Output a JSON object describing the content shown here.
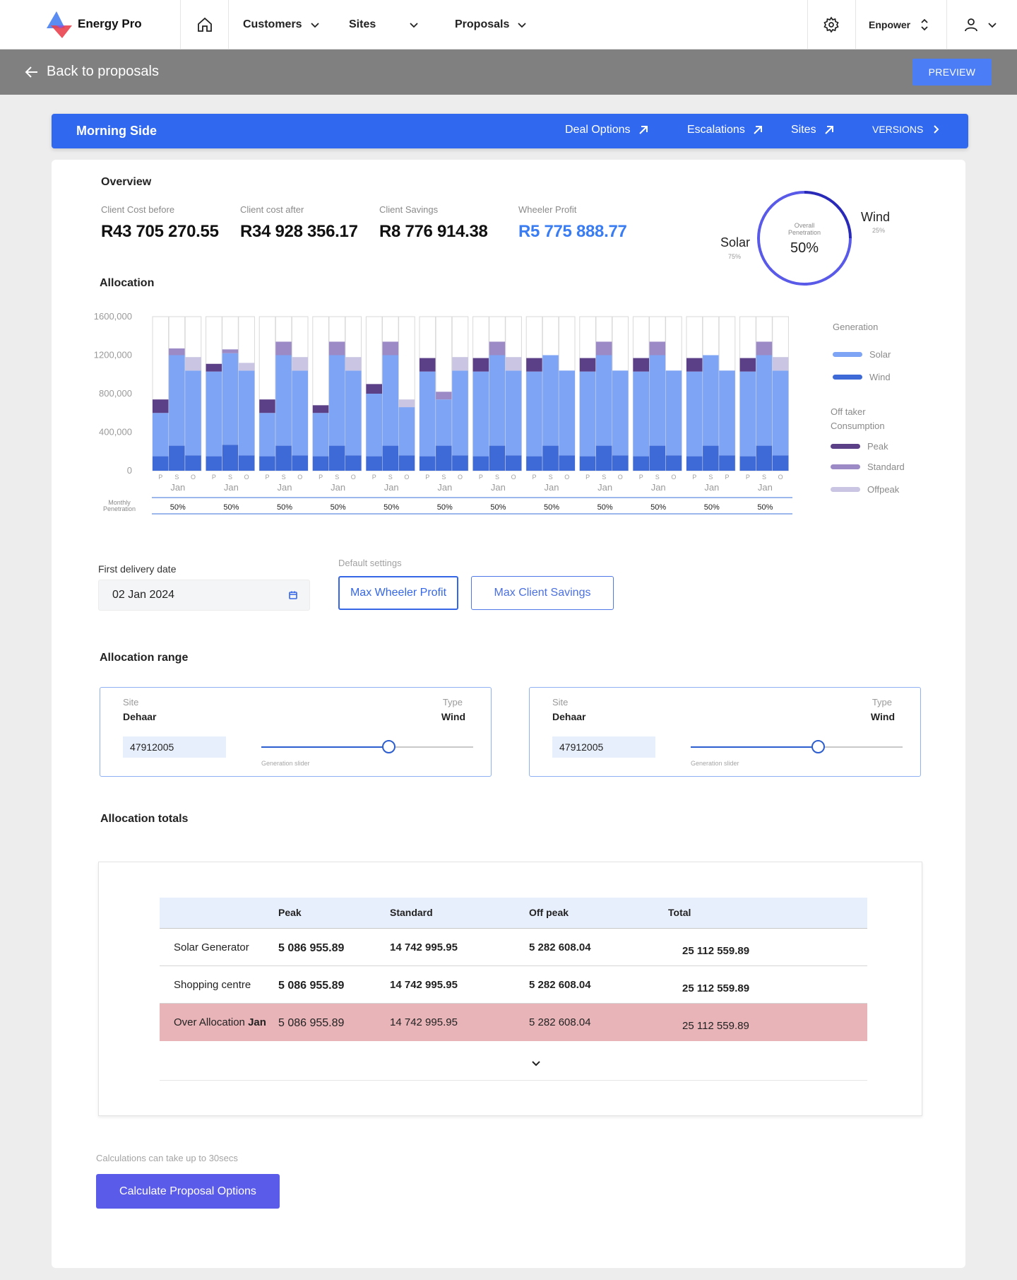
{
  "nav": {
    "brand": "Energy Pro",
    "items": [
      "Customers",
      "Sites",
      "Proposals"
    ],
    "org": "Enpower"
  },
  "backbar": {
    "back_label": "Back to proposals",
    "preview_label": "PREVIEW"
  },
  "header": {
    "title": "Morning Side",
    "links": [
      "Deal Options",
      "Escalations",
      "Sites",
      "VERSIONS"
    ]
  },
  "overview": {
    "title": "Overview",
    "kpis": [
      {
        "label": "Client Cost before",
        "value": "R43 705 270.55"
      },
      {
        "label": "Client cost after",
        "value": "R34 928 356.17"
      },
      {
        "label": "Client Savings",
        "value": "R8 776 914.38"
      },
      {
        "label": "Wheeler Profit",
        "value": "R5 775 888.77"
      }
    ],
    "donut": {
      "center_label_1": "Overall",
      "center_label_2": "Penetration",
      "center_value": "50%",
      "solar_label": "Solar",
      "solar_pct": "75%",
      "wind_label": "Wind",
      "wind_pct": "25%",
      "solar_fraction": 0.75,
      "colors": {
        "solar": "#5a5ae8",
        "wind": "#2a2ab8"
      }
    }
  },
  "allocation": {
    "title": "Allocation",
    "penetration_label_1": "Monthly",
    "penetration_label_2": "Penetration",
    "legend": {
      "generation_title": "Generation",
      "generation": [
        {
          "label": "Solar",
          "color": "#7ea4f5"
        },
        {
          "label": "Wind",
          "color": "#3e6ad8"
        }
      ],
      "offtaker_title_1": "Off taker",
      "offtaker_title_2": "Consumption",
      "offtaker": [
        {
          "label": "Peak",
          "color": "#5b3f87"
        },
        {
          "label": "Standard",
          "color": "#9b8ac6"
        },
        {
          "label": "Offpeak",
          "color": "#c9c5e2"
        }
      ]
    }
  },
  "chart_data": {
    "type": "bar",
    "stacked": true,
    "ylim": [
      0,
      1600000
    ],
    "yticks": [
      "1600,000",
      "1200,000",
      "800,000",
      "400,000",
      "0"
    ],
    "ytick_values": [
      1600000,
      1200000,
      800000,
      400000,
      0
    ],
    "grid": true,
    "legend_position": "right",
    "month_labels": [
      "Jan",
      "Jan",
      "Jan",
      "Jan",
      "Jan",
      "Jan",
      "Jan",
      "Jan",
      "Jan",
      "Jan",
      "Jan",
      "Jan"
    ],
    "penetration": [
      "50%",
      "50%",
      "50%",
      "50%",
      "50%",
      "50%",
      "50%",
      "50%",
      "50%",
      "50%",
      "50%",
      "50%"
    ],
    "groups": [
      {
        "subs": [
          {
            "l": "P",
            "wind": 150000,
            "solar": 450000,
            "cap": {
              "k": "peak",
              "v": 140000
            }
          },
          {
            "l": "S",
            "wind": 260000,
            "solar": 940000,
            "cap": {
              "k": "standard",
              "v": 70000
            }
          },
          {
            "l": "O",
            "wind": 160000,
            "solar": 880000,
            "cap": {
              "k": "offpeak",
              "v": 140000
            }
          }
        ]
      },
      {
        "subs": [
          {
            "l": "P",
            "wind": 150000,
            "solar": 880000,
            "cap": {
              "k": "peak",
              "v": 80000
            }
          },
          {
            "l": "S",
            "wind": 270000,
            "solar": 950000,
            "cap": {
              "k": "standard",
              "v": 40000
            }
          },
          {
            "l": "O",
            "wind": 160000,
            "solar": 880000,
            "cap": {
              "k": "offpeak",
              "v": 80000
            }
          }
        ]
      },
      {
        "subs": [
          {
            "l": "P",
            "wind": 150000,
            "solar": 450000,
            "cap": {
              "k": "peak",
              "v": 140000
            }
          },
          {
            "l": "S",
            "wind": 260000,
            "solar": 940000,
            "cap": {
              "k": "standard",
              "v": 140000
            }
          },
          {
            "l": "O",
            "wind": 160000,
            "solar": 880000,
            "cap": {
              "k": "offpeak",
              "v": 140000
            }
          }
        ]
      },
      {
        "subs": [
          {
            "l": "P",
            "wind": 150000,
            "solar": 450000,
            "cap": {
              "k": "peak",
              "v": 80000
            }
          },
          {
            "l": "S",
            "wind": 260000,
            "solar": 940000,
            "cap": {
              "k": "standard",
              "v": 140000
            }
          },
          {
            "l": "O",
            "wind": 160000,
            "solar": 880000,
            "cap": {
              "k": "offpeak",
              "v": 140000
            }
          }
        ]
      },
      {
        "subs": [
          {
            "l": "P",
            "wind": 150000,
            "solar": 650000,
            "cap": {
              "k": "peak",
              "v": 100000
            }
          },
          {
            "l": "S",
            "wind": 260000,
            "solar": 940000,
            "cap": {
              "k": "standard",
              "v": 140000
            }
          },
          {
            "l": "O",
            "wind": 160000,
            "solar": 500000,
            "cap": {
              "k": "offpeak",
              "v": 80000
            }
          }
        ]
      },
      {
        "subs": [
          {
            "l": "P",
            "wind": 150000,
            "solar": 880000,
            "cap": {
              "k": "peak",
              "v": 140000
            }
          },
          {
            "l": "S",
            "wind": 260000,
            "solar": 480000,
            "cap": {
              "k": "standard",
              "v": 80000
            }
          },
          {
            "l": "O",
            "wind": 160000,
            "solar": 880000,
            "cap": {
              "k": "offpeak",
              "v": 140000
            }
          }
        ]
      },
      {
        "subs": [
          {
            "l": "P",
            "wind": 150000,
            "solar": 880000,
            "cap": {
              "k": "peak",
              "v": 140000
            }
          },
          {
            "l": "S",
            "wind": 260000,
            "solar": 940000,
            "cap": {
              "k": "standard",
              "v": 140000
            }
          },
          {
            "l": "O",
            "wind": 160000,
            "solar": 880000,
            "cap": {
              "k": "offpeak",
              "v": 140000
            }
          }
        ]
      },
      {
        "subs": [
          {
            "l": "P",
            "wind": 150000,
            "solar": 880000,
            "cap": {
              "k": "peak",
              "v": 140000
            }
          },
          {
            "l": "S",
            "wind": 260000,
            "solar": 940000,
            "cap": {
              "k": "standard",
              "v": 0
            }
          },
          {
            "l": "O",
            "wind": 160000,
            "solar": 880000,
            "cap": {
              "k": "offpeak",
              "v": 0
            }
          }
        ]
      },
      {
        "subs": [
          {
            "l": "P",
            "wind": 150000,
            "solar": 880000,
            "cap": {
              "k": "peak",
              "v": 140000
            }
          },
          {
            "l": "S",
            "wind": 260000,
            "solar": 940000,
            "cap": {
              "k": "standard",
              "v": 140000
            }
          },
          {
            "l": "O",
            "wind": 160000,
            "solar": 880000,
            "cap": {
              "k": "offpeak",
              "v": 0
            }
          }
        ]
      },
      {
        "subs": [
          {
            "l": "P",
            "wind": 150000,
            "solar": 880000,
            "cap": {
              "k": "peak",
              "v": 140000
            }
          },
          {
            "l": "S",
            "wind": 260000,
            "solar": 940000,
            "cap": {
              "k": "standard",
              "v": 140000
            }
          },
          {
            "l": "O",
            "wind": 160000,
            "solar": 880000,
            "cap": {
              "k": "offpeak",
              "v": 0
            }
          }
        ]
      },
      {
        "subs": [
          {
            "l": "P",
            "wind": 150000,
            "solar": 880000,
            "cap": {
              "k": "peak",
              "v": 140000
            }
          },
          {
            "l": "S",
            "wind": 260000,
            "solar": 940000,
            "cap": {
              "k": "standard",
              "v": 0
            }
          },
          {
            "l": "P",
            "wind": 160000,
            "solar": 880000,
            "cap": {
              "k": "offpeak",
              "v": 0
            }
          }
        ]
      },
      {
        "subs": [
          {
            "l": "P",
            "wind": 150000,
            "solar": 880000,
            "cap": {
              "k": "peak",
              "v": 140000
            }
          },
          {
            "l": "S",
            "wind": 260000,
            "solar": 940000,
            "cap": {
              "k": "standard",
              "v": 140000
            }
          },
          {
            "l": "O",
            "wind": 160000,
            "solar": 880000,
            "cap": {
              "k": "offpeak",
              "v": 140000
            }
          }
        ]
      }
    ]
  },
  "form": {
    "date_label": "First delivery date",
    "date_value": "02 Jan 2024",
    "defaults_label": "Default settings",
    "btn_max_wheeler": "Max Wheeler Profit",
    "btn_max_client": "Max Client Savings"
  },
  "range": {
    "title": "Allocation range",
    "boxes": [
      {
        "site_label": "Site",
        "site": "Dehaar",
        "type_label": "Type",
        "type": "Wind",
        "value": "47912005",
        "slider_caption": "Generation slider",
        "slider_fraction": 0.6
      },
      {
        "site_label": "Site",
        "site": "Dehaar",
        "type_label": "Type",
        "type": "Wind",
        "value": "47912005",
        "slider_caption": "Generation slider",
        "slider_fraction": 0.6
      }
    ]
  },
  "totals": {
    "title": "Allocation totals",
    "headers": [
      "",
      "Peak",
      "Standard",
      "Off peak",
      "Total"
    ],
    "rows": [
      {
        "name": "Solar Generator",
        "name_suffix": "",
        "peak": "5 086 955.89",
        "standard": "14 742 995.95",
        "offpeak": "5 282 608.04",
        "total": "25 112 559.89"
      },
      {
        "name": "Shopping centre",
        "name_suffix": "",
        "peak": "5 086 955.89",
        "standard": "14 742 995.95",
        "offpeak": "5 282 608.04",
        "total": "25 112 559.89"
      },
      {
        "name": "Over Allocation ",
        "name_suffix": "Jan",
        "peak": "5 086 955.89",
        "standard": "14 742 995.95",
        "offpeak": "5 282 608.04",
        "total": "25 112 559.89"
      }
    ]
  },
  "calc": {
    "note": "Calculations can take up to 30secs",
    "button": "Calculate Proposal Options"
  }
}
